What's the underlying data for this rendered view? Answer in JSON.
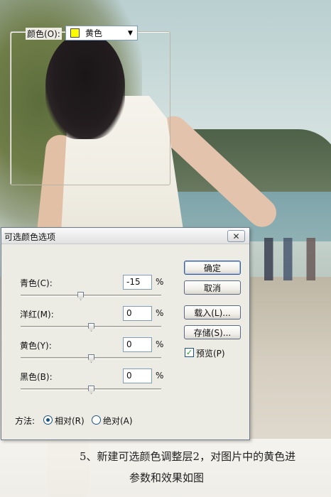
{
  "dialog": {
    "title": "可选颜色选项",
    "close_glyph": "✕",
    "color_label": "颜色(O):",
    "color_value": "黄色",
    "swatch_color": "#ffff00",
    "sliders": [
      {
        "label": "青色(C):",
        "value": "-15",
        "unit": "%",
        "level": -15
      },
      {
        "label": "洋红(M):",
        "value": "0",
        "unit": "%",
        "level": 0
      },
      {
        "label": "黄色(Y):",
        "value": "0",
        "unit": "%",
        "level": 0
      },
      {
        "label": "黑色(B):",
        "value": "0",
        "unit": "%",
        "level": 0
      }
    ],
    "method_label": "方法:",
    "method_options": [
      "相对(R)",
      "绝对(A)"
    ],
    "method_selected": "相对(R)",
    "buttons": {
      "ok": "确定",
      "cancel": "取消",
      "load": "载入(L)...",
      "save": "存储(S)..."
    },
    "preview_label": "预览(P)",
    "preview_checked": true
  },
  "caption": {
    "line1": "5、新建可选颜色调整层2，对图片中的黄色进",
    "line2": "参数和效果如图"
  }
}
